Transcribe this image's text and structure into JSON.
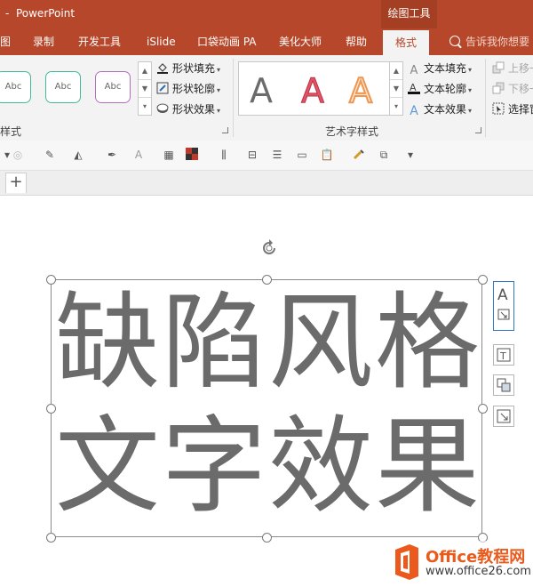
{
  "window": {
    "app_title": "PowerPoint",
    "contextual_group": "绘图工具"
  },
  "tabs": [
    {
      "label": "图"
    },
    {
      "label": "录制"
    },
    {
      "label": "开发工具"
    },
    {
      "label": "iSlide"
    },
    {
      "label": "口袋动画 PA"
    },
    {
      "label": "美化大师"
    },
    {
      "label": "帮助"
    },
    {
      "label": "格式"
    }
  ],
  "tell_me": {
    "placeholder": "告诉我你想要"
  },
  "ribbon": {
    "shape_styles": {
      "samples": [
        "Abc",
        "Abc",
        "Abc"
      ],
      "fill": "形状填充",
      "outline": "形状轮廓",
      "effects": "形状效果",
      "group_label": "样式"
    },
    "wordart": {
      "samples": [
        "A",
        "A",
        "A"
      ],
      "text_fill": "文本填充",
      "text_outline": "文本轮廓",
      "text_effects": "文本效果",
      "group_label": "艺术字样式"
    },
    "arrange": {
      "bring_forward": "上移一",
      "send_backward": "下移一",
      "selection_pane": "选择窗"
    }
  },
  "slide": {
    "line1": "缺陷风格",
    "line2": "文字效果"
  },
  "watermark": {
    "brand": "Office教程网",
    "url": "www.office26.com"
  },
  "colors": {
    "accent": "#b7472a",
    "text_gray": "#6b6b6b"
  }
}
